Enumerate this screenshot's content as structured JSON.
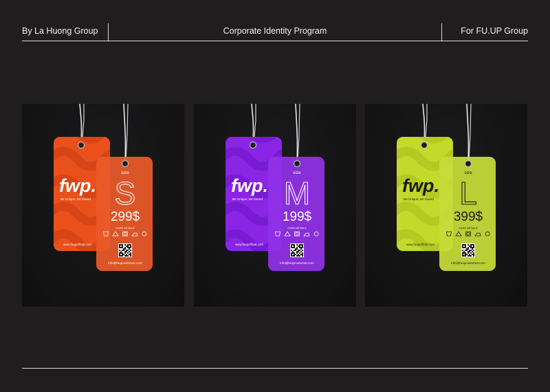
{
  "header": {
    "left": "By La Huong Group",
    "center": "Corporate Identity Program",
    "right": "For FU.UP Group"
  },
  "brand": {
    "logo_text": "fwp.",
    "tagline": "Be Unique, Be Saved",
    "website": "www.fuupofficial.com",
    "size_caption": "size",
    "care_heading": "CARE DETAILS",
    "email": "info@fuupcustomer.com"
  },
  "tags": [
    {
      "size": "S",
      "price": "299$",
      "color": "#e9501c",
      "color_dark": "#c93d12",
      "ink": "#ffffff"
    },
    {
      "size": "M",
      "price": "199$",
      "color": "#8a25e6",
      "color_dark": "#6d14c4",
      "ink": "#ffffff"
    },
    {
      "size": "L",
      "price": "399$",
      "color": "#c3d92b",
      "color_dark": "#a7bd1c",
      "ink": "#1a1a1a"
    }
  ],
  "icons": [
    "wash-icon",
    "bleach-icon",
    "dry-icon",
    "iron-icon",
    "dryclean-icon"
  ]
}
